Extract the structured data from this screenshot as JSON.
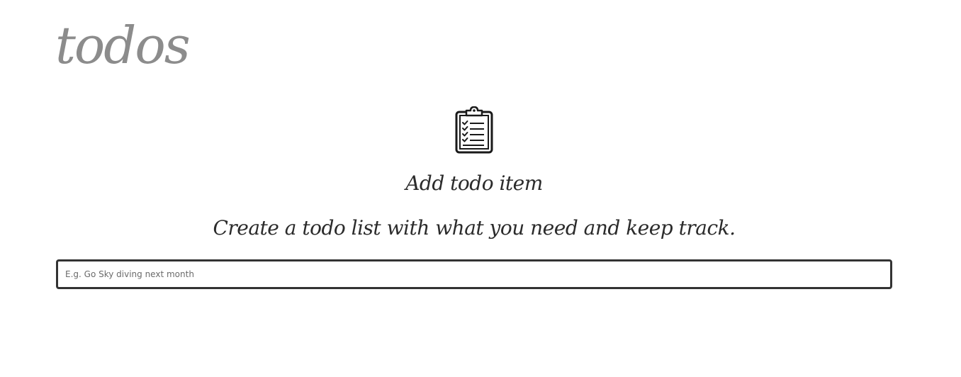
{
  "header": {
    "title": "todos"
  },
  "empty_state": {
    "icon": "clipboard-checklist-icon",
    "heading": "Add todo item",
    "subtext": "Create a todo list with what you need and keep track."
  },
  "new_todo": {
    "placeholder": "E.g. Go Sky diving next month",
    "value": ""
  },
  "colors": {
    "title": "#8c8c8c",
    "text": "#2b2b2b",
    "input_border": "#333333",
    "background": "#ffffff"
  }
}
